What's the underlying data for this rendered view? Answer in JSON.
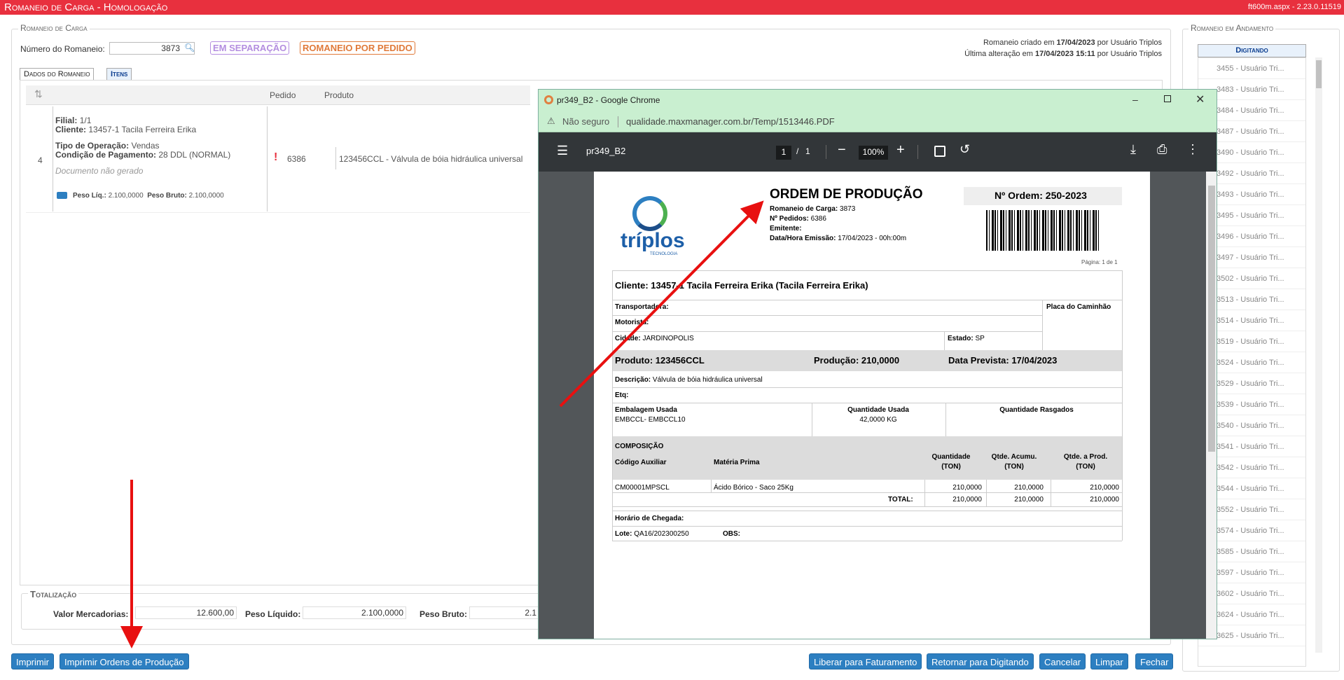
{
  "app": {
    "title": "Romaneio de Carga  - Homologação",
    "version": "ft600m.aspx - 2.23.0.11519"
  },
  "romaneio": {
    "legend": "Romaneio de Carga",
    "numero_label": "Número do Romaneio:",
    "numero_value": "3873",
    "status_badge": "EM SEPARAÇÃO",
    "type_badge": "ROMANEIO POR PEDIDO",
    "created_prefix": "Romaneio criado em",
    "created_date": "17/04/2023",
    "created_suffix": "por Usuário Triplos",
    "changed_prefix": "Última alteração em",
    "changed_date": "17/04/2023 15:11",
    "changed_suffix": "por Usuário Triplos"
  },
  "tabs": [
    {
      "label": "Dados do Romaneio"
    },
    {
      "label": "Itens"
    }
  ],
  "grid": {
    "headers": {
      "sort": "⇅",
      "pedido": "Pedido",
      "produto": "Produto"
    },
    "row": {
      "index": "4",
      "filial_label": "Filial:",
      "filial": "1/1",
      "cliente_label": "Cliente:",
      "cliente": "13457-1 Tacila Ferreira Erika",
      "tipo_label": "Tipo de Operação:",
      "tipo": "Vendas",
      "cond_label": "Condição de Pagamento:",
      "cond": "28 DDL (NORMAL)",
      "doc": "Documento não gerado",
      "peso_liq_label": "Peso Líq.:",
      "peso_liq": "2.100,0000",
      "peso_bruto_label": "Peso Bruto:",
      "peso_bruto": "2.100,0000",
      "pedido": "6386",
      "produto": "123456CCL - Válvula de bóia hidráulica universal"
    }
  },
  "totalizacao": {
    "legend": "Totalização",
    "valor_label": "Valor Mercadorias:",
    "valor": "12.600,00",
    "peso_liq_label": "Peso Líquido:",
    "peso_liq": "2.100,0000",
    "peso_bruto_label": "Peso Bruto:",
    "peso_bruto": "2.1"
  },
  "buttons": {
    "imprimir": "Imprimir",
    "imprimir_ordens": "Imprimir Ordens de Produção",
    "liberar": "Liberar para Faturamento",
    "retornar": "Retornar para Digitando",
    "cancelar": "Cancelar",
    "limpar": "Limpar",
    "fechar": "Fechar"
  },
  "sidebar": {
    "legend": "Romaneio em Andamento",
    "header": "Digitando",
    "items": [
      "3455 - Usuário Tri...",
      "3483 - Usuário Tri...",
      "3484 - Usuário Tri...",
      "3487 - Usuário Tri...",
      "3490 - Usuário Tri...",
      "3492 - Usuário Tri...",
      "3493 - Usuário Tri...",
      "3495 - Usuário Tri...",
      "3496 - Usuário Tri...",
      "3497 - Usuário Tri...",
      "3502 - Usuário Tri...",
      "3513 - Usuário Tri...",
      "3514 - Usuário Tri...",
      "3519 - Usuário Tri...",
      "3524 - Usuário Tri...",
      "3529 - Usuário Tri...",
      "3539 - Usuário Tri...",
      "3540 - Usuário Tri...",
      "3541 - Usuário Tri...",
      "3542 - Usuário Tri...",
      "3544 - Usuário Tri...",
      "3552 - Usuário Tri...",
      "3574 - Usuário Tri...",
      "3585 - Usuário Tri...",
      "3597 - Usuário Tri...",
      "3602 - Usuário Tri...",
      "3624 - Usuário Tri...",
      "3625 - Usuário Tri..."
    ]
  },
  "chrome": {
    "title": "pr349_B2 - Google Chrome",
    "not_secure": "Não seguro",
    "url": "qualidade.maxmanager.com.br/Temp/1513446.PDF",
    "doc_name": "pr349_B2",
    "page_current": "1",
    "page_sep": "/",
    "page_total": "1",
    "zoom": "100%"
  },
  "pdf": {
    "logo_name": "tríplos",
    "logo_sub": "TECNOLOGIA",
    "title": "ORDEM DE PRODUÇÃO",
    "ordem_label": "Nº Ordem:",
    "ordem": "250-2023",
    "romaneio_label": "Romaneio de Carga:",
    "romaneio": "3873",
    "pedidos_label": "Nº Pedidos:",
    "pedidos": "6386",
    "emitente_label": "Emitente:",
    "emissao_label": "Data/Hora Emissão:",
    "emissao": "17/04/2023 - 00h:00m",
    "pagina": "Página: 1 de 1",
    "cliente": "Cliente: 13457-1 Tacila Ferreira Erika (Tacila Ferreira Erika)",
    "transportadora_label": "Transportadora:",
    "placa_label": "Placa do Caminhão",
    "motorista_label": "Motorista:",
    "cidade_label": "Cidade:",
    "cidade": "JARDINOPOLIS",
    "estado_label": "Estado:",
    "estado": "SP",
    "produto": "Produto: 123456CCL",
    "producao": "Produção: 210,0000",
    "data_prevista": "Data Prevista: 17/04/2023",
    "descricao_label": "Descrição:",
    "descricao": "Válvula de bóia hidráulica universal",
    "etq_label": "Etq:",
    "embalagem_label": "Embalagem Usada",
    "embalagem": "EMBCCL- EMBCCL10",
    "qtd_usada_label": "Quantidade Usada",
    "qtd_usada": "42,0000 KG",
    "qtd_rasgados_label": "Quantidade Rasgados",
    "composicao": "COMPOSIÇÃO",
    "col_codigo": "Código Auxiliar",
    "col_materia": "Matéria Prima",
    "col_qtd": "Quantidade",
    "col_qtd_acum": "Qtde. Acumu.",
    "col_qtd_prod": "Qtde. a Prod.",
    "col_unit": "(TON)",
    "comp_codigo": "CM00001MPSCL",
    "comp_materia": "Ácido Bórico - Saco 25Kg",
    "comp_qtd": "210,0000",
    "comp_acum": "210,0000",
    "comp_prod": "210,0000",
    "total_label": "TOTAL:",
    "total_qtd": "210,0000",
    "total_acum": "210,0000",
    "total_prod": "210,0000",
    "horario_label": "Horário de Chegada:",
    "lote_label": "Lote:",
    "lote": "QA16/202300250",
    "obs_label": "OBS:"
  },
  "colors": {
    "topbar": "#e8303e",
    "button": "#2d7fc1",
    "status_badge": "#b48ee0",
    "type_badge": "#e07a3a",
    "arrow": "#e81010"
  }
}
